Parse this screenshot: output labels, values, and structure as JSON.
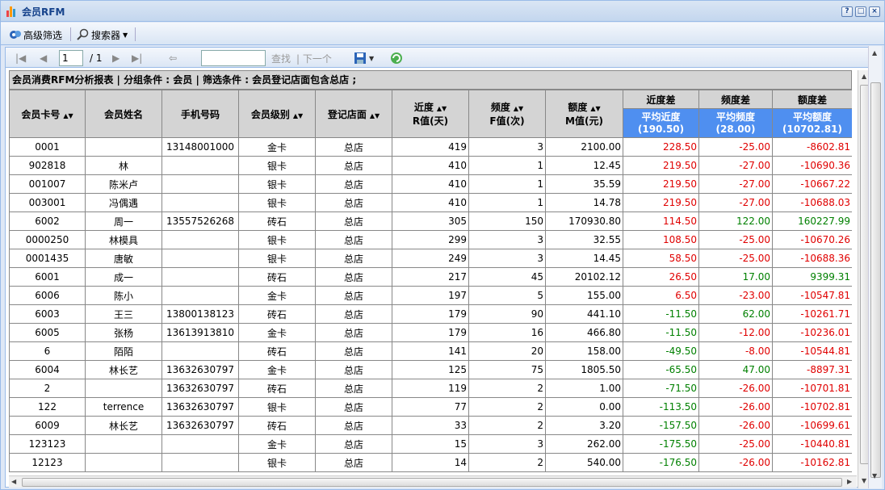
{
  "window": {
    "title": "会员RFM",
    "help_btn": "?",
    "max_btn": "□",
    "close_btn": "×"
  },
  "toolbar": {
    "advanced_filter": "高级筛选",
    "searcher": "搜索器"
  },
  "pager": {
    "page_value": "1",
    "page_total": "/ 1",
    "find_value": "",
    "find_label": "查找",
    "next_label": "| 下一个"
  },
  "report": {
    "caption": "会员消费RFM分析报表 | 分组条件 : 会员 | 筛选条件 : 会员登记店面包含总店 ;",
    "headers": {
      "card_no": "会员卡号",
      "name": "会员姓名",
      "phone": "手机号码",
      "level": "会员级别",
      "store": "登记店面",
      "recency_1": "近度",
      "recency_2": "R值(天)",
      "freq_1": "频度",
      "freq_2": "F值(次)",
      "amount_1": "额度",
      "amount_2": "M值(元)",
      "recency_diff": "近度差",
      "freq_diff": "频度差",
      "amount_diff": "额度差",
      "avg_recency_1": "平均近度",
      "avg_recency_2": "(190.50)",
      "avg_freq_1": "平均频度",
      "avg_freq_2": "(28.00)",
      "avg_amount_1": "平均额度",
      "avg_amount_2": "(10702.81)"
    },
    "rows": [
      {
        "card": "0001",
        "name": "",
        "phone": "13148001000",
        "level": "金卡",
        "store": "总店",
        "r": "419",
        "f": "3",
        "m": "2100.00",
        "rd": "228.50",
        "fd": "-25.00",
        "md": "-8602.81",
        "rdc": "red",
        "fdc": "red",
        "mdc": "red"
      },
      {
        "card": "902818",
        "name": "林",
        "phone": "",
        "level": "银卡",
        "store": "总店",
        "r": "410",
        "f": "1",
        "m": "12.45",
        "rd": "219.50",
        "fd": "-27.00",
        "md": "-10690.36",
        "rdc": "red",
        "fdc": "red",
        "mdc": "red"
      },
      {
        "card": "001007",
        "name": "陈米卢",
        "phone": "",
        "level": "银卡",
        "store": "总店",
        "r": "410",
        "f": "1",
        "m": "35.59",
        "rd": "219.50",
        "fd": "-27.00",
        "md": "-10667.22",
        "rdc": "red",
        "fdc": "red",
        "mdc": "red"
      },
      {
        "card": "003001",
        "name": "冯偶遇",
        "phone": "",
        "level": "银卡",
        "store": "总店",
        "r": "410",
        "f": "1",
        "m": "14.78",
        "rd": "219.50",
        "fd": "-27.00",
        "md": "-10688.03",
        "rdc": "red",
        "fdc": "red",
        "mdc": "red"
      },
      {
        "card": "6002",
        "name": "周一",
        "phone": "13557526268",
        "level": "砖石",
        "store": "总店",
        "r": "305",
        "f": "150",
        "m": "170930.80",
        "rd": "114.50",
        "fd": "122.00",
        "md": "160227.99",
        "rdc": "red",
        "fdc": "green",
        "mdc": "green"
      },
      {
        "card": "0000250",
        "name": "林模具",
        "phone": "",
        "level": "银卡",
        "store": "总店",
        "r": "299",
        "f": "3",
        "m": "32.55",
        "rd": "108.50",
        "fd": "-25.00",
        "md": "-10670.26",
        "rdc": "red",
        "fdc": "red",
        "mdc": "red"
      },
      {
        "card": "0001435",
        "name": "唐敏",
        "phone": "",
        "level": "银卡",
        "store": "总店",
        "r": "249",
        "f": "3",
        "m": "14.45",
        "rd": "58.50",
        "fd": "-25.00",
        "md": "-10688.36",
        "rdc": "red",
        "fdc": "red",
        "mdc": "red"
      },
      {
        "card": "6001",
        "name": "成一",
        "phone": "",
        "level": "砖石",
        "store": "总店",
        "r": "217",
        "f": "45",
        "m": "20102.12",
        "rd": "26.50",
        "fd": "17.00",
        "md": "9399.31",
        "rdc": "red",
        "fdc": "green",
        "mdc": "green"
      },
      {
        "card": "6006",
        "name": "陈小",
        "phone": "",
        "level": "金卡",
        "store": "总店",
        "r": "197",
        "f": "5",
        "m": "155.00",
        "rd": "6.50",
        "fd": "-23.00",
        "md": "-10547.81",
        "rdc": "red",
        "fdc": "red",
        "mdc": "red"
      },
      {
        "card": "6003",
        "name": "王三",
        "phone": "13800138123",
        "level": "砖石",
        "store": "总店",
        "r": "179",
        "f": "90",
        "m": "441.10",
        "rd": "-11.50",
        "fd": "62.00",
        "md": "-10261.71",
        "rdc": "green",
        "fdc": "green",
        "mdc": "red"
      },
      {
        "card": "6005",
        "name": "张杨",
        "phone": "13613913810",
        "level": "金卡",
        "store": "总店",
        "r": "179",
        "f": "16",
        "m": "466.80",
        "rd": "-11.50",
        "fd": "-12.00",
        "md": "-10236.01",
        "rdc": "green",
        "fdc": "red",
        "mdc": "red"
      },
      {
        "card": "6",
        "name": "陌陌",
        "phone": "",
        "level": "砖石",
        "store": "总店",
        "r": "141",
        "f": "20",
        "m": "158.00",
        "rd": "-49.50",
        "fd": "-8.00",
        "md": "-10544.81",
        "rdc": "green",
        "fdc": "red",
        "mdc": "red"
      },
      {
        "card": "6004",
        "name": "林长艺",
        "phone": "13632630797",
        "level": "金卡",
        "store": "总店",
        "r": "125",
        "f": "75",
        "m": "1805.50",
        "rd": "-65.50",
        "fd": "47.00",
        "md": "-8897.31",
        "rdc": "green",
        "fdc": "green",
        "mdc": "red"
      },
      {
        "card": "2",
        "name": "",
        "phone": "13632630797",
        "level": "砖石",
        "store": "总店",
        "r": "119",
        "f": "2",
        "m": "1.00",
        "rd": "-71.50",
        "fd": "-26.00",
        "md": "-10701.81",
        "rdc": "green",
        "fdc": "red",
        "mdc": "red"
      },
      {
        "card": "122",
        "name": "terrence",
        "phone": "13632630797",
        "level": "银卡",
        "store": "总店",
        "r": "77",
        "f": "2",
        "m": "0.00",
        "rd": "-113.50",
        "fd": "-26.00",
        "md": "-10702.81",
        "rdc": "green",
        "fdc": "red",
        "mdc": "red"
      },
      {
        "card": "6009",
        "name": "林长艺",
        "phone": "13632630797",
        "level": "砖石",
        "store": "总店",
        "r": "33",
        "f": "2",
        "m": "3.20",
        "rd": "-157.50",
        "fd": "-26.00",
        "md": "-10699.61",
        "rdc": "green",
        "fdc": "red",
        "mdc": "red"
      },
      {
        "card": "123123",
        "name": "",
        "phone": "",
        "level": "金卡",
        "store": "总店",
        "r": "15",
        "f": "3",
        "m": "262.00",
        "rd": "-175.50",
        "fd": "-25.00",
        "md": "-10440.81",
        "rdc": "green",
        "fdc": "red",
        "mdc": "red"
      },
      {
        "card": "12123",
        "name": "",
        "phone": "",
        "level": "银卡",
        "store": "总店",
        "r": "14",
        "f": "2",
        "m": "540.00",
        "rd": "-176.50",
        "fd": "-26.00",
        "md": "-10162.81",
        "rdc": "green",
        "fdc": "red",
        "mdc": "red"
      }
    ]
  },
  "colors": {
    "header_blue": "#4f8ff0",
    "positive": "#e00000",
    "negative": "#008000"
  },
  "icons": [
    "chart-icon",
    "filter-icon",
    "search-icon",
    "first-page-icon",
    "prev-page-icon",
    "next-page-icon",
    "last-page-icon",
    "refresh-icon",
    "save-icon",
    "reload-icon"
  ]
}
